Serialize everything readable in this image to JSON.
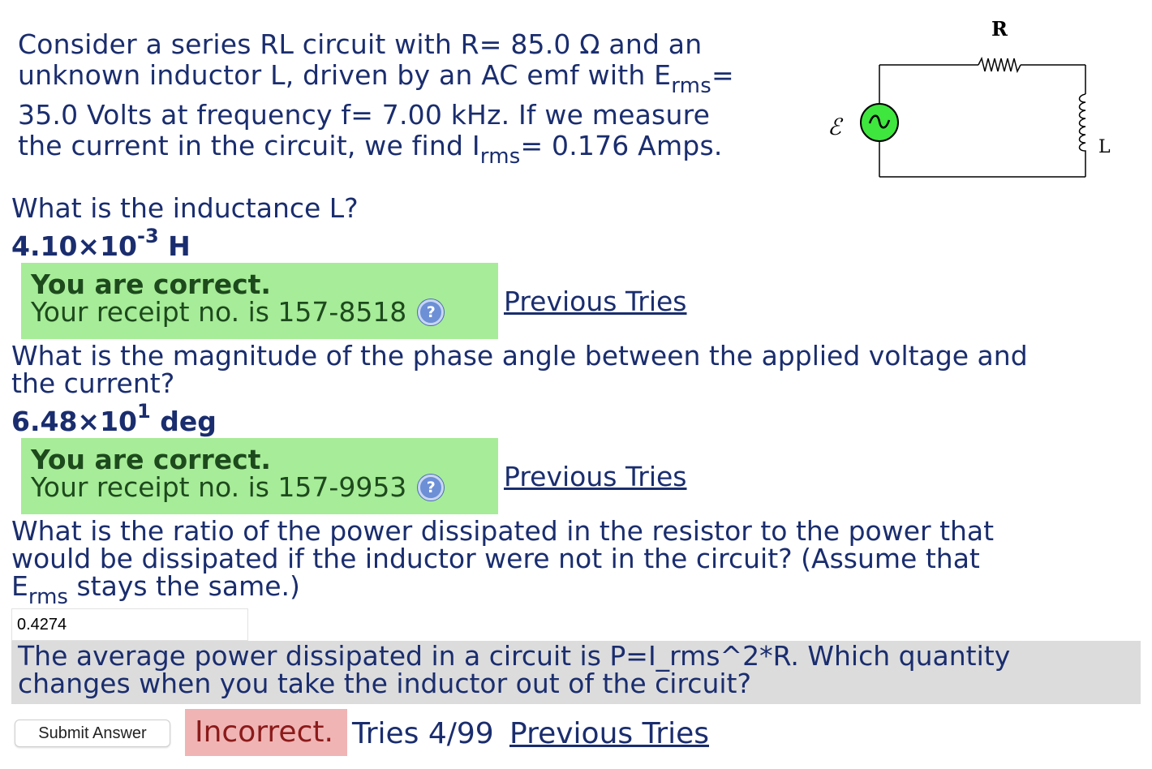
{
  "problem": {
    "line1": "Consider a series RL circuit with R= 85.0 Ω and an",
    "line2_a": "unknown inductor L, driven by an AC emf with E",
    "line2_sub": "rms",
    "line2_b": "=",
    "line3": "35.0 Volts at frequency f= 7.00 kHz. If we measure",
    "line4_a": "the current in the circuit, we find I",
    "line4_sub": "rms",
    "line4_b": "= 0.176 Amps."
  },
  "circuit": {
    "resistor_label": "R",
    "inductor_label": "L",
    "emf_label": "ℰ",
    "source_symbol": "~"
  },
  "q1": {
    "text": "What is the inductance L?",
    "answer_mantissa": "4.10×10",
    "answer_exp": "-3",
    "answer_unit": " H",
    "correct_title": "You are correct.",
    "receipt": "Your receipt no. is 157-8518",
    "help_icon": "?",
    "prev_tries": "Previous Tries"
  },
  "q2": {
    "text_line1": "What is the magnitude of the phase angle between the applied voltage and",
    "text_line2": "the current?",
    "answer_mantissa": "6.48×10",
    "answer_exp": "1",
    "answer_unit": " deg",
    "correct_title": "You are correct.",
    "receipt": "Your receipt no. is 157-9953",
    "help_icon": "?",
    "prev_tries": "Previous Tries"
  },
  "q3": {
    "text_line1": "What is the ratio of the power dissipated in the resistor to the power that",
    "text_line2": "would be dissipated if the inductor were not in the circuit? (Assume that",
    "text_line3_a": "E",
    "text_line3_sub": "rms",
    "text_line3_b": " stays the same.)",
    "input_value": "0.4274",
    "hint_line1": "The average power dissipated in a circuit is P=I_rms^2*R. Which quantity",
    "hint_line2": "changes when you take the inductor out of the circuit?",
    "submit_label": "Submit Answer",
    "status": "Incorrect.",
    "tries": "Tries 4/99",
    "prev_tries": "Previous Tries"
  },
  "colors": {
    "text": "#1a2d6e",
    "correct_bg": "#a7ec98",
    "incorrect_bg": "#f0b4b4",
    "hint_bg": "#dcdcdc",
    "source_green": "#3ee63e"
  }
}
